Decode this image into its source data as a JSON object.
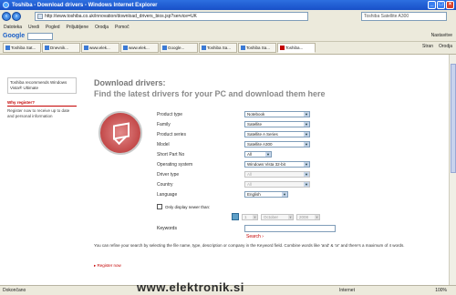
{
  "window": {
    "title": "Toshiba - Download drivers - Windows Internet Explorer"
  },
  "addressbar": {
    "url": "http://www.toshiba.co.uk/innovation/download_drivers_bios.jsp?service=UK",
    "search_placeholder": "Toshiba Satellite A300"
  },
  "menubar": {
    "items": [
      "Datoteka",
      "Uredi",
      "Pogled",
      "Priljubljene",
      "Orodja",
      "Pomoč"
    ]
  },
  "googlebar": {
    "logo": "Google",
    "right_items": [
      "Nastavitve"
    ]
  },
  "tabs": [
    {
      "label": "Toshiba Sat...",
      "active": false
    },
    {
      "label": "Dnevnik...",
      "active": false
    },
    {
      "label": "www.elek...",
      "active": false
    },
    {
      "label": "www.elek...",
      "active": false
    },
    {
      "label": "Google...",
      "active": false
    },
    {
      "label": "Toshiba Sa...",
      "active": false
    },
    {
      "label": "Toshiba Sa...",
      "active": false
    },
    {
      "label": "Toshiba...",
      "active": true
    }
  ],
  "tabtools": [
    "Stran",
    "Orodja"
  ],
  "leftpanel": {
    "banner": "Toshiba recommends Windows Vista® Ultimate",
    "why_register": "Why register?",
    "why_text": "Register now to receive up to date and personal information"
  },
  "main": {
    "heading1": "Download drivers:",
    "heading2": "Find the latest drivers for your PC and download them here",
    "fields": [
      {
        "label": "Product type",
        "value": "Notebook",
        "disabled": false
      },
      {
        "label": "Family",
        "value": "Satellite",
        "disabled": false
      },
      {
        "label": "Product series",
        "value": "Satellite A Series",
        "disabled": false
      },
      {
        "label": "Model",
        "value": "Satellite A300",
        "disabled": false
      },
      {
        "label": "Short Part No",
        "value": "All",
        "disabled": false
      },
      {
        "label": "Operating system",
        "value": "Windows Vista 32-bit",
        "disabled": false
      },
      {
        "label": "Driver type",
        "value": "All",
        "disabled": true
      },
      {
        "label": "Country",
        "value": "All",
        "disabled": true
      },
      {
        "label": "Language",
        "value": "English",
        "disabled": false
      }
    ],
    "checkbox_label": "Only display newer than:",
    "date": {
      "day": "1",
      "month": "October",
      "year": "2008"
    },
    "keywords_label": "Keywords",
    "search_label": "Search",
    "description": "You can refine your search by selecting the file name, type, description or company in the Keyword field. Combine words like 'and' & 'or' and there's a maximum of 4 words.",
    "register_link": "Register now"
  },
  "statusbar": {
    "left": "Dokončano",
    "watermark": "www.elektronik.si",
    "zone": "Internet",
    "zoom": "100%"
  }
}
